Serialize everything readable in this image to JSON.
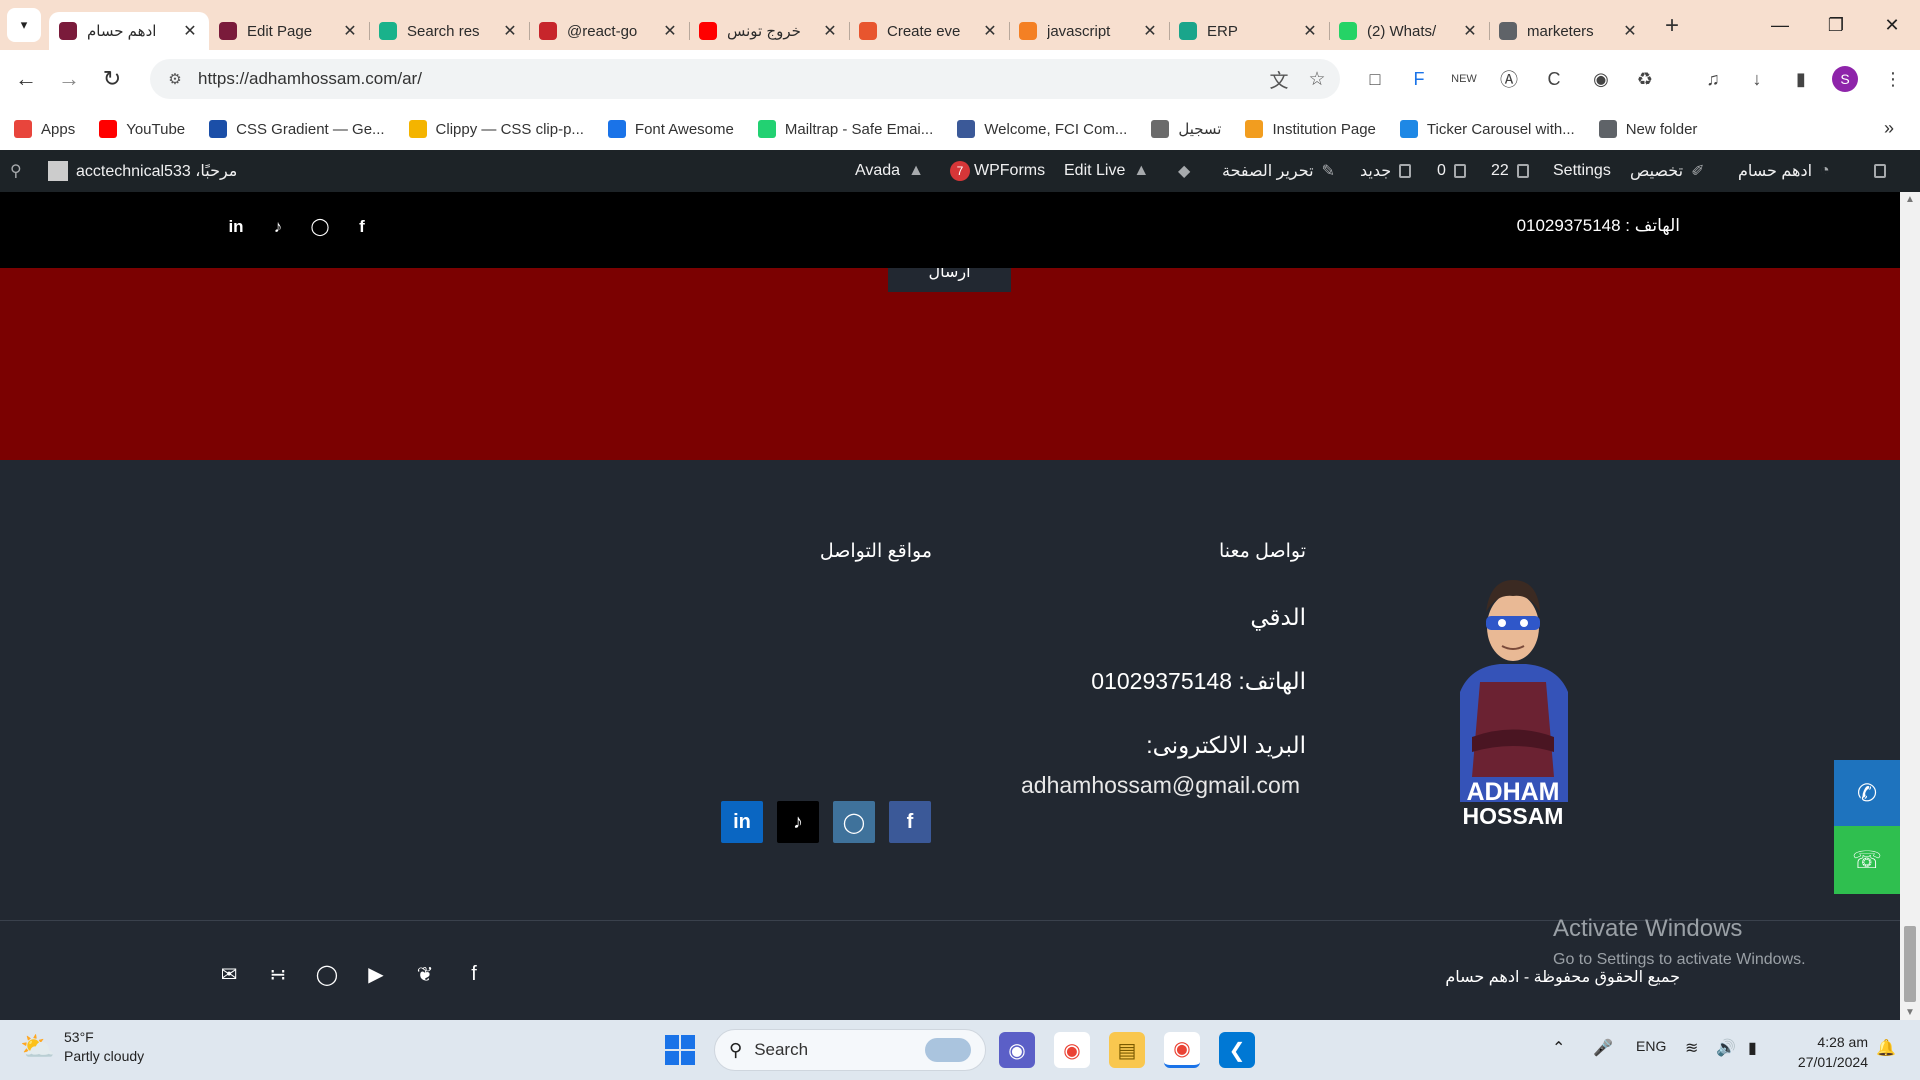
{
  "browser": {
    "tabs": [
      {
        "title": "ادهم حسام",
        "favicon_color": "#7a1b3b",
        "active": true
      },
      {
        "title": "Edit Page",
        "favicon_color": "#7a1b3b",
        "active": false
      },
      {
        "title": "Search res",
        "favicon_color": "#19b28b",
        "active": false
      },
      {
        "title": "@react-go",
        "favicon_color": "#c7252b",
        "active": false
      },
      {
        "title": "خروج تونس",
        "favicon_color": "#ff0000",
        "active": false
      },
      {
        "title": "Create eve",
        "favicon_color": "#e8552e",
        "active": false
      },
      {
        "title": "javascript",
        "favicon_color": "#f48024",
        "active": false
      },
      {
        "title": "ERP",
        "favicon_color": "#1aa58b",
        "active": false
      },
      {
        "title": "(2) Whats/",
        "favicon_color": "#25d366",
        "active": false
      },
      {
        "title": "marketers",
        "favicon_color": "#5f6368",
        "active": false
      }
    ],
    "url": "https://adhamhossam.com/ar/",
    "bookmarks": [
      {
        "label": "Apps",
        "icon": "apps-grid-icon",
        "color": "#e8453c"
      },
      {
        "label": "YouTube",
        "icon": "youtube-icon",
        "color": "#ff0000"
      },
      {
        "label": "CSS Gradient — Ge...",
        "icon": "css-gradient-icon",
        "color": "#1b4fa8"
      },
      {
        "label": "Clippy — CSS clip-p...",
        "icon": "clippy-icon",
        "color": "#f4b400"
      },
      {
        "label": "Font Awesome",
        "icon": "flag-icon",
        "color": "#1a73e8"
      },
      {
        "label": "Mailtrap - Safe Emai...",
        "icon": "mailtrap-icon",
        "color": "#22d172"
      },
      {
        "label": "Welcome, FCI Com...",
        "icon": "fci-icon",
        "color": "#3b5998"
      },
      {
        "label": "تسجيل",
        "icon": "shield-icon",
        "color": "#6b6b6b"
      },
      {
        "label": "Institution Page",
        "icon": "institution-icon",
        "color": "#f29d1f"
      },
      {
        "label": "Ticker Carousel with...",
        "icon": "ticker-icon",
        "color": "#1e88e5"
      },
      {
        "label": "New folder",
        "icon": "folder-icon",
        "color": "#5f6368"
      }
    ]
  },
  "wpbar": {
    "greeting": "مرحبًا، acctechnical533",
    "avada": "Avada",
    "wpforms_count": "7",
    "wpforms": "WPForms",
    "edit_live": "Edit Live",
    "edit_page": "تحرير الصفحة",
    "new": "جديد",
    "comments": "0",
    "updates": "22",
    "settings": "Settings",
    "customize": "تخصيص",
    "site_name": "ادهم حسام"
  },
  "page": {
    "topbar_phone": "الهاتف : 01029375148",
    "send_button": "ارسال",
    "contact_title": "تواصل معنا",
    "social_title": "مواقع التواصل",
    "address": "الدقي",
    "phone_line": "الهاتف: 01029375148",
    "email_label": "البريد الالكترونى:",
    "email": "adhamhossam@gmail.com",
    "avatar_text_1": "ADHAM",
    "avatar_text_2": "HOSSAM",
    "copyright": "جميع الحقوق محفوظة - ادهم حسام",
    "social_colors": {
      "linkedin": "#0a66c2",
      "tiktok": "#000000",
      "instagram": "#3f729b",
      "facebook": "#3b5998"
    }
  },
  "overlay": {
    "activate_title": "Activate Windows",
    "activate_sub": "Go to Settings to activate Windows."
  },
  "taskbar": {
    "temp": "53°F",
    "condition": "Partly cloudy",
    "search": "Search",
    "lang": "ENG",
    "time": "4:28 am",
    "date": "27/01/2024"
  }
}
